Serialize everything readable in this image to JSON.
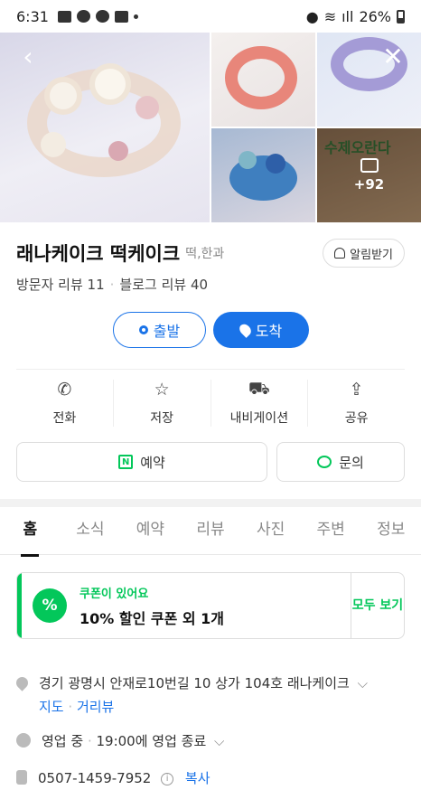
{
  "statusbar": {
    "time": "6:31",
    "battery": "26%"
  },
  "gallery": {
    "more_count": "+92",
    "sign_text": "수제오란다"
  },
  "place": {
    "name": "래나케이크 떡케이크",
    "category": "떡,한과",
    "alarm_label": "알림받기"
  },
  "reviews": {
    "visitor": "방문자 리뷰 11",
    "blog": "블로그 리뷰 40"
  },
  "route": {
    "depart": "출발",
    "arrive": "도착"
  },
  "actions": [
    {
      "label": "전화",
      "icon": "phone-icon"
    },
    {
      "label": "저장",
      "icon": "star-icon"
    },
    {
      "label": "내비게이션",
      "icon": "car-icon"
    },
    {
      "label": "공유",
      "icon": "share-icon"
    }
  ],
  "buttons": {
    "reserve": "예약",
    "inquiry": "문의"
  },
  "tabs": [
    "홈",
    "소식",
    "예약",
    "리뷰",
    "사진",
    "주변",
    "정보"
  ],
  "coupon": {
    "kicker": "쿠폰이 있어요",
    "title": "10% 할인 쿠폰 외 1개",
    "view_all": "모두 보기",
    "badge": "%"
  },
  "info": {
    "address": "경기 광명시 안재로10번길 10 상가 104호 래나케이크",
    "map_link": "지도",
    "street_view": "거리뷰",
    "status": "영업 중",
    "hours": "19:00에 영업 종료",
    "phone": "0507-1459-7952",
    "copy": "복사"
  },
  "colors": {
    "accent": "#1a73e8",
    "brand_green": "#03c75a"
  }
}
